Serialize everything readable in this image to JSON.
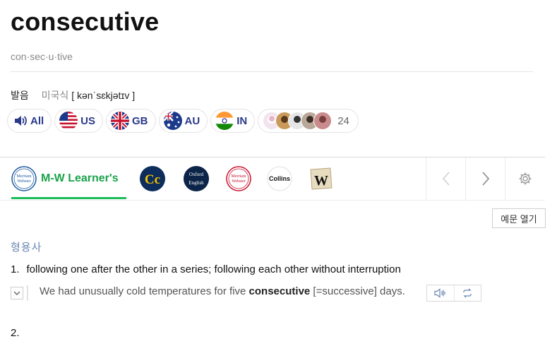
{
  "entry": {
    "word": "consecutive",
    "syllables": "con·sec·u·tive"
  },
  "pronunciation": {
    "label": "발음",
    "dialect": "미국식",
    "ipa": "[ kənˈsɛkjətɪv ]"
  },
  "audio_buttons": [
    {
      "label": "All",
      "icon": "speaker-icon"
    },
    {
      "label": "US",
      "icon": "us-flag-icon"
    },
    {
      "label": "GB",
      "icon": "gb-flag-icon"
    },
    {
      "label": "AU",
      "icon": "au-flag-icon"
    },
    {
      "label": "IN",
      "icon": "in-flag-icon"
    }
  ],
  "user_pronunciations": {
    "count": "24"
  },
  "dictionaries": {
    "active": "M-W Learner's",
    "logos": [
      "Merriam Webster",
      "Cc",
      "Oxford English",
      "Merriam Webster",
      "Collins",
      "W"
    ]
  },
  "controls": {
    "open_examples": "예문 열기"
  },
  "sense": {
    "pos": "형용사",
    "number": "1.",
    "definition": "following one after the other in a series; following each other without interruption",
    "example_pre": "We had unusually cold temperatures for five ",
    "example_bold": "consecutive",
    "example_post": " [=successive] days.",
    "next_number": "2."
  },
  "colors": {
    "accent_green": "#1dbe5a",
    "label_blue": "#2b3a8a",
    "pos_blue": "#6a86b4"
  }
}
